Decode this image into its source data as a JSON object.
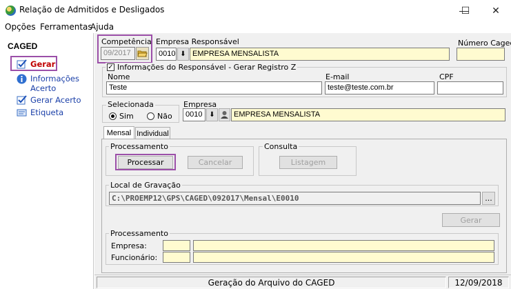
{
  "window": {
    "title": "Relação de Admitidos e Desligados",
    "minimize": "—",
    "maximize": "☐",
    "close": "✕"
  },
  "menu": {
    "items": [
      "Opções",
      "Ferramentas",
      "Ajuda"
    ]
  },
  "sidebar": {
    "title": "CAGED",
    "items": [
      {
        "label": "Gerar",
        "icon": "checkmark-icon"
      },
      {
        "label": "Informações",
        "label2": "Acerto",
        "icon": "info-icon"
      },
      {
        "label": "Gerar Acerto",
        "icon": "checkmark-icon"
      },
      {
        "label": "Etiqueta",
        "icon": "label-icon"
      }
    ]
  },
  "header": {
    "competencia_label": "Competência",
    "competencia_value": "09/2017",
    "empresa_resp_label": "Empresa Responsável",
    "empresa_resp_code": "0010",
    "empresa_resp_name": "EMPRESA MENSALISTA",
    "numero_caged_label": "Número Caged",
    "numero_caged_value": ""
  },
  "responsavel": {
    "group_label": "Informações do Responsável - Gerar Registro Z",
    "checked": "✓",
    "nome_label": "Nome",
    "nome_value": "Teste",
    "email_label": "E-mail",
    "email_value": "teste@teste.com.br",
    "cpf_label": "CPF",
    "cpf_value": ""
  },
  "selecionada": {
    "label": "Selecionada",
    "sim": "Sim",
    "nao": "Não"
  },
  "empresa": {
    "label": "Empresa",
    "code": "0010",
    "name": "EMPRESA MENSALISTA"
  },
  "tabs": [
    "Mensal",
    "Individual"
  ],
  "processamento": {
    "label": "Processamento",
    "processar": "Processar",
    "cancelar": "Cancelar"
  },
  "consulta": {
    "label": "Consulta",
    "listagem": "Listagem"
  },
  "gravacao": {
    "label": "Local de Gravação",
    "path": "C:\\PROEMP12\\GPS\\CAGED\\092017\\Mensal\\E0010",
    "browse": "..."
  },
  "gerar_button": "Gerar",
  "processamento2": {
    "label": "Processamento",
    "empresa_label": "Empresa:",
    "funcionario_label": "Funcionário:"
  },
  "status": {
    "message": "Geração do Arquivo do CAGED",
    "date": "12/09/2018"
  }
}
